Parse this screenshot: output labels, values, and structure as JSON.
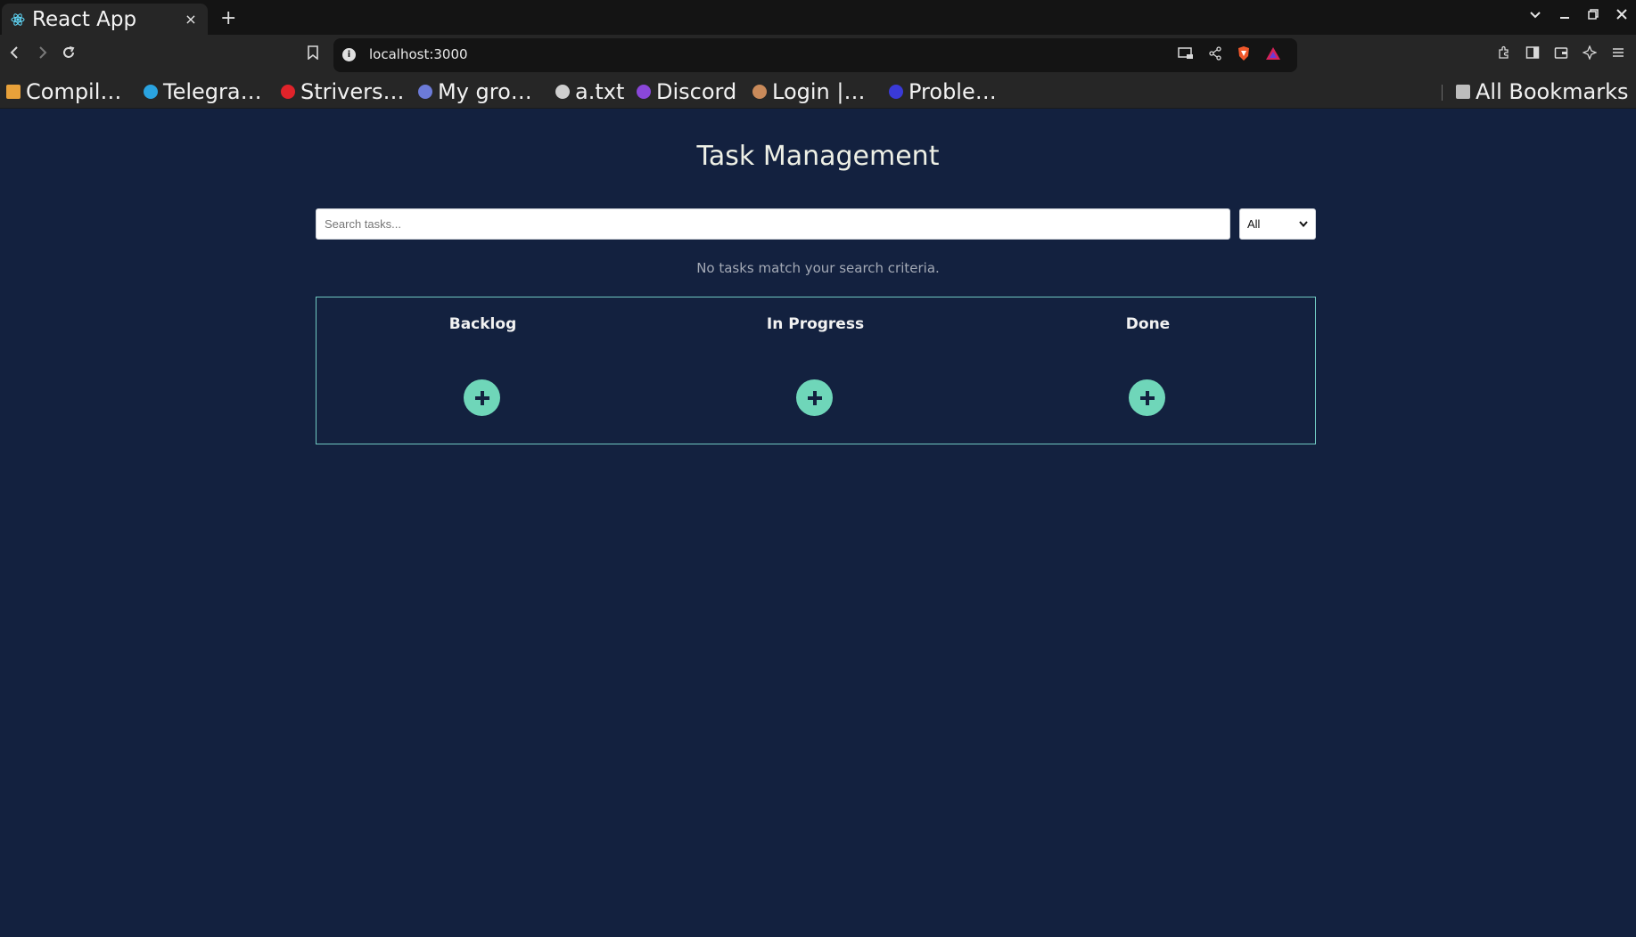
{
  "browser": {
    "tab_title": "React App",
    "tab_close": "×",
    "new_tab": "+",
    "url": "localhost:3000",
    "bookmarks": [
      {
        "label": "Compil…",
        "icon": "cc-icon",
        "color": "#e8a13a"
      },
      {
        "label": "Telegra…",
        "icon": "telegram-icon",
        "color": "#2aa3e0"
      },
      {
        "label": "Strivers…",
        "icon": "tuf-icon",
        "color": "#e0232a"
      },
      {
        "label": "My gro…",
        "icon": "group-icon",
        "color": "#6c7bd8"
      },
      {
        "label": "a.txt",
        "icon": "globe-icon",
        "color": "#cfcfcf"
      },
      {
        "label": "Discord",
        "icon": "discord-icon",
        "color": "#8a47d9"
      },
      {
        "label": "Login |…",
        "icon": "login-icon",
        "color": "#c98a5a"
      },
      {
        "label": "Proble…",
        "icon": "problem-icon",
        "color": "#3a3ad8"
      }
    ],
    "all_bookmarks": "All Bookmarks"
  },
  "app": {
    "title": "Task Management",
    "search_placeholder": "Search tasks...",
    "filter_value": "All",
    "empty_message": "No tasks match your search criteria.",
    "columns": [
      {
        "title": "Backlog"
      },
      {
        "title": "In Progress"
      },
      {
        "title": "Done"
      }
    ]
  },
  "colors": {
    "background": "#13213f",
    "accent": "#6fd6b9",
    "board_border": "#6fc8c1"
  }
}
